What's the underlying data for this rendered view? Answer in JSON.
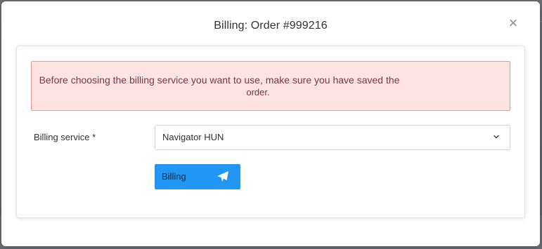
{
  "modal": {
    "title": "Billing: Order #999216",
    "close_label": "×"
  },
  "alert": {
    "line1": "Before choosing the billing service you want to use, make sure you have saved the",
    "line2": "order."
  },
  "form": {
    "billing_service_label": "Billing service *",
    "billing_service_value": "Navigator HUN",
    "submit_label": "Billing"
  },
  "icons": {
    "close": "close-icon",
    "chevron": "chevron-down-icon",
    "send": "paper-plane-icon"
  },
  "colors": {
    "primary_button": "#2196f3",
    "alert_background": "#fde4e0",
    "alert_border": "#f2978c",
    "alert_text": "#7f3548"
  }
}
